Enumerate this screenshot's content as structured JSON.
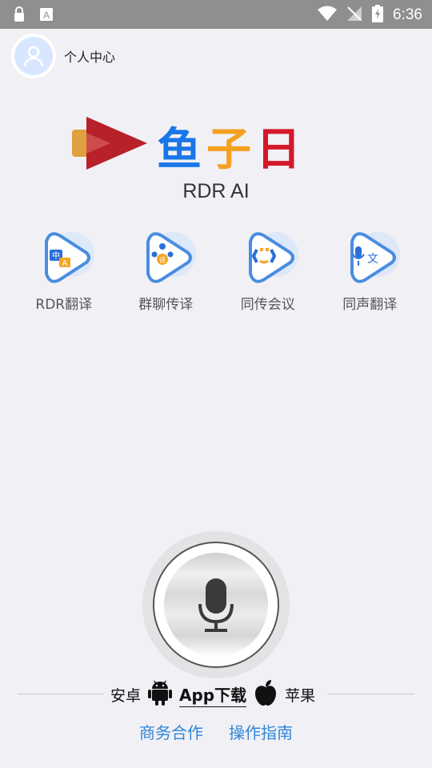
{
  "status_bar": {
    "time": "6:36",
    "icons_left": [
      "lock-icon",
      "font-a-icon"
    ],
    "icons_right": [
      "wifi-icon",
      "no-signal-icon",
      "battery-charging-icon"
    ]
  },
  "profile": {
    "label": "个人中心"
  },
  "logo": {
    "chars": [
      "鱼",
      "子",
      "日"
    ],
    "colors": [
      "#1976e8",
      "#f5a020",
      "#d4182a"
    ]
  },
  "app_name": "RDR AI",
  "features": [
    {
      "label": "RDR翻译",
      "icon": "translate-icon",
      "icon_text": "中"
    },
    {
      "label": "群聊传译",
      "icon": "group-chat-icon",
      "icon_text": "译"
    },
    {
      "label": "同传会议",
      "icon": "meeting-icon"
    },
    {
      "label": "同声翻译",
      "icon": "voice-translate-icon",
      "icon_text": "文"
    }
  ],
  "download": {
    "android": "安卓",
    "app": "App下载",
    "apple": "苹果"
  },
  "links": {
    "business": "商务合作",
    "guide": "操作指南"
  },
  "colors": {
    "accent": "#2f86d8",
    "background": "#f1f0f5"
  }
}
